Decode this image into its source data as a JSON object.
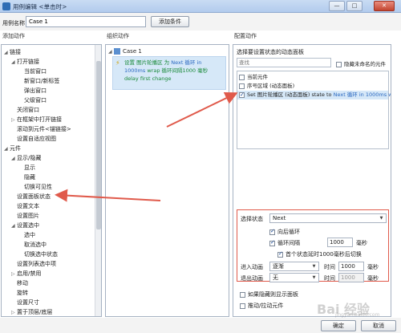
{
  "window": {
    "title": "用例编辑 <单击时>",
    "minimize": "—",
    "maximize": "□",
    "close": "✕"
  },
  "case_name": {
    "label": "用例名称",
    "value": "Case 1",
    "add_condition": "添加条件"
  },
  "left": {
    "header": "添加动作",
    "items": [
      {
        "text": "链接",
        "arrow": "◢",
        "indent": 0
      },
      {
        "text": "打开链接",
        "arrow": "◢",
        "indent": 1
      },
      {
        "text": "当前窗口",
        "arrow": "",
        "indent": 2
      },
      {
        "text": "新窗口/新标签",
        "arrow": "",
        "indent": 2
      },
      {
        "text": "弹出窗口",
        "arrow": "",
        "indent": 2
      },
      {
        "text": "父级窗口",
        "arrow": "",
        "indent": 2
      },
      {
        "text": "关闭窗口",
        "arrow": "",
        "indent": 1
      },
      {
        "text": "在框架中打开链接",
        "arrow": "▷",
        "indent": 1
      },
      {
        "text": "滚动到元件<锚链接>",
        "arrow": "",
        "indent": 1
      },
      {
        "text": "设置自适应视图",
        "arrow": "",
        "indent": 1
      },
      {
        "text": "元件",
        "arrow": "◢",
        "indent": 0
      },
      {
        "text": "显示/隐藏",
        "arrow": "◢",
        "indent": 1
      },
      {
        "text": "显示",
        "arrow": "",
        "indent": 2
      },
      {
        "text": "隐藏",
        "arrow": "",
        "indent": 2
      },
      {
        "text": "切换可见性",
        "arrow": "",
        "indent": 2
      },
      {
        "text": "设置面板状态",
        "arrow": "",
        "indent": 1
      },
      {
        "text": "设置文本",
        "arrow": "",
        "indent": 1
      },
      {
        "text": "设置图片",
        "arrow": "",
        "indent": 1
      },
      {
        "text": "设置选中",
        "arrow": "◢",
        "indent": 1
      },
      {
        "text": "选中",
        "arrow": "",
        "indent": 2
      },
      {
        "text": "取消选中",
        "arrow": "",
        "indent": 2
      },
      {
        "text": "切换选中状态",
        "arrow": "",
        "indent": 2
      },
      {
        "text": "设置列表选中项",
        "arrow": "",
        "indent": 1
      },
      {
        "text": "启用/禁用",
        "arrow": "▷",
        "indent": 1
      },
      {
        "text": "移动",
        "arrow": "",
        "indent": 1
      },
      {
        "text": "旋转",
        "arrow": "",
        "indent": 1
      },
      {
        "text": "设置尺寸",
        "arrow": "",
        "indent": 1
      },
      {
        "text": "置于顶层/底层",
        "arrow": "▷",
        "indent": 1
      }
    ]
  },
  "middle": {
    "header": "组织动作",
    "case_label": "Case 1",
    "action_prefix": "设置 图片轮播区 为",
    "action_blue": "Next 循环 in 1000ms",
    "action_suffix": "wrap 循环间隔1000 毫秒 delay first change"
  },
  "right": {
    "header": "配置动作",
    "subheader": "选择要设置状态的动态面板",
    "search_placeholder": "查找",
    "hide_unnamed": "隐藏未命名的元件",
    "items": [
      {
        "text": "当前元件",
        "checked": false,
        "selected": false
      },
      {
        "text": "序号区域 (动态面板)",
        "checked": false,
        "selected": false
      },
      {
        "text": "Set 图片轮播区 (动态面板) state to",
        "blue": "Next 循环 in 1000ms wra",
        "checked": true,
        "selected": true
      }
    ],
    "state_label": "选择状态",
    "state_value": "Next",
    "loop_label": "向后循环",
    "interval_label": "循环间隔",
    "interval_value": "1000",
    "interval_unit": "毫秒",
    "first_switch_label": "首个状态延时1000毫秒后切换",
    "enter_anim_label": "进入动画",
    "enter_anim_value": "逐渐",
    "time_label": "时间",
    "enter_time": "1000",
    "ms_unit": "毫秒",
    "exit_anim_label": "退出动画",
    "exit_anim_value": "无",
    "exit_time": "1000",
    "bottom_opt1": "如果隐藏则显示面板",
    "bottom_opt2": "推动/拉动元件"
  },
  "footer": {
    "ok": "确定",
    "cancel": "取消"
  },
  "watermark": {
    "main": "Bai 经验",
    "sub": "jingyan.baidu.com"
  },
  "colors": {
    "arrow": "#e05a4b",
    "selection": "#d6e8f8",
    "link_blue": "#2a68c0",
    "action_green": "#1a8a3a"
  }
}
